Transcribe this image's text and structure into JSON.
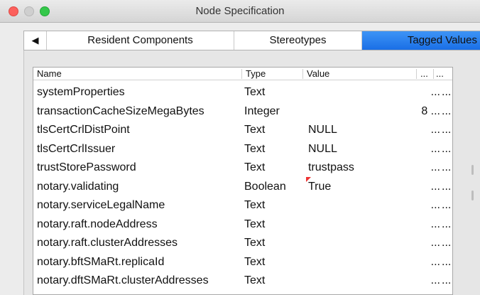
{
  "window": {
    "title": "Node Specification"
  },
  "tabs": {
    "scroll_left": "◀",
    "items": [
      {
        "label": "Resident Components"
      },
      {
        "label": "Stereotypes"
      },
      {
        "label": "Tagged Values",
        "selected": true
      }
    ]
  },
  "table": {
    "headers": {
      "name": "Name",
      "type": "Type",
      "value": "Value",
      "extra1": "...",
      "extra2": "..."
    },
    "rows": [
      {
        "name": "systemProperties",
        "type": "Text",
        "value": "",
        "d1": "...",
        "d2": "..."
      },
      {
        "name": "transactionCacheSizeMegaBytes",
        "type": "Integer",
        "value": "",
        "d1": "8 ...",
        "d2": "..."
      },
      {
        "name": "tlsCertCrlDistPoint",
        "type": "Text",
        "value": "NULL",
        "d1": "...",
        "d2": "..."
      },
      {
        "name": "tlsCertCrlIssuer",
        "type": "Text",
        "value": "NULL",
        "d1": "...",
        "d2": "..."
      },
      {
        "name": "trustStorePassword",
        "type": "Text",
        "value": "trustpass",
        "d1": "...",
        "d2": "..."
      },
      {
        "name": "notary.validating",
        "type": "Boolean",
        "value": "True",
        "d1": "...",
        "d2": "..."
      },
      {
        "name": "notary.serviceLegalName",
        "type": "Text",
        "value": "",
        "d1": "...",
        "d2": "..."
      },
      {
        "name": "notary.raft.nodeAddress",
        "type": "Text",
        "value": "",
        "d1": "...",
        "d2": "..."
      },
      {
        "name": "notary.raft.clusterAddresses",
        "type": "Text",
        "value": "",
        "d1": "...",
        "d2": "..."
      },
      {
        "name": "notary.bftSMaRt.replicaId",
        "type": "Text",
        "value": "",
        "d1": "...",
        "d2": "..."
      },
      {
        "name": "notary.dftSMaRt.clusterAddresses",
        "type": "Text",
        "value": "",
        "d1": "...",
        "d2": "..."
      }
    ]
  },
  "colors": {
    "selected_tab": "#1a6fe6",
    "close": "#fc605c",
    "maximize": "#34c84a"
  }
}
